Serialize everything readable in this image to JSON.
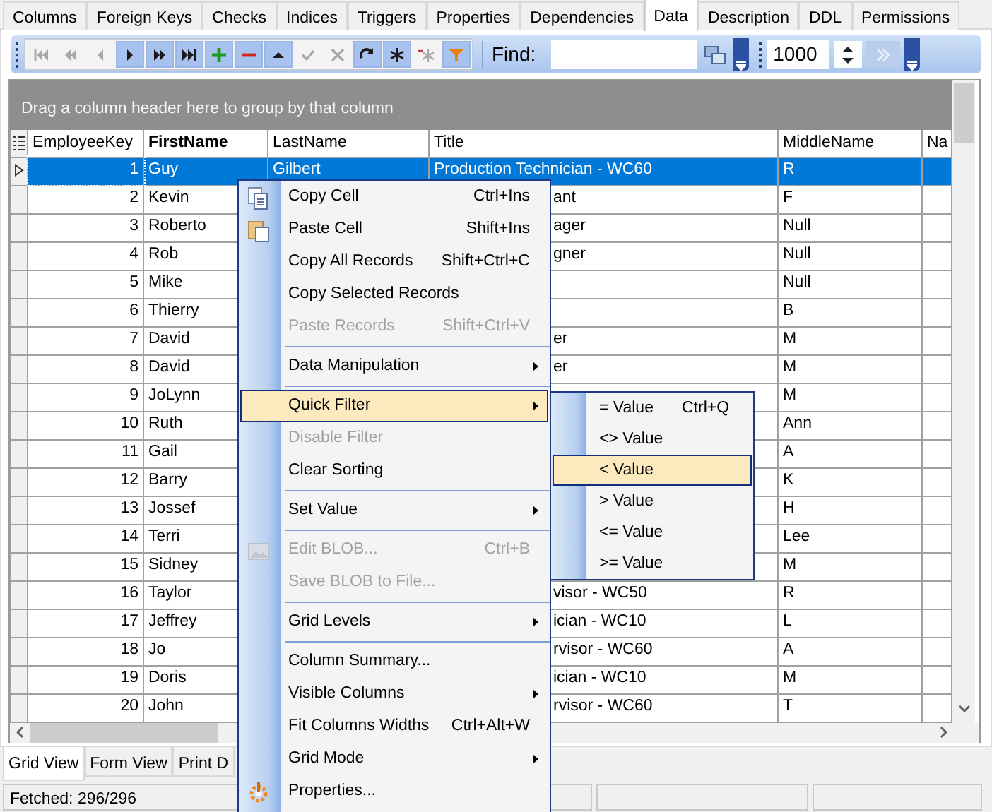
{
  "tabs": [
    {
      "label": "Columns",
      "selected": false
    },
    {
      "label": "Foreign Keys",
      "selected": false
    },
    {
      "label": "Checks",
      "selected": false
    },
    {
      "label": "Indices",
      "selected": false
    },
    {
      "label": "Triggers",
      "selected": false
    },
    {
      "label": "Properties",
      "selected": false
    },
    {
      "label": "Dependencies",
      "selected": false
    },
    {
      "label": "Data",
      "selected": true
    },
    {
      "label": "Description",
      "selected": false
    },
    {
      "label": "DDL",
      "selected": false
    },
    {
      "label": "Permissions",
      "selected": false
    }
  ],
  "toolbar": {
    "buttons": [
      {
        "kind": "first",
        "disabled": true
      },
      {
        "kind": "prior-page",
        "disabled": true
      },
      {
        "kind": "prior",
        "disabled": true
      },
      {
        "kind": "next",
        "disabled": false
      },
      {
        "kind": "next-page",
        "disabled": false
      },
      {
        "kind": "last",
        "disabled": false
      },
      {
        "kind": "insert",
        "disabled": false
      },
      {
        "kind": "delete",
        "disabled": false
      },
      {
        "kind": "edit",
        "disabled": false
      },
      {
        "kind": "post",
        "disabled": true
      },
      {
        "kind": "cancel",
        "disabled": true
      },
      {
        "kind": "refresh",
        "disabled": false
      },
      {
        "kind": "bookmark",
        "disabled": false
      },
      {
        "kind": "goto-bookmark",
        "disabled": true
      },
      {
        "kind": "filter",
        "disabled": false
      }
    ],
    "find_label": "Find:",
    "record_count": "1000"
  },
  "group_panel": "Drag a column header here to group by that column",
  "grid": {
    "columns": [
      {
        "label": "EmployeeKey",
        "selected": false
      },
      {
        "label": "FirstName",
        "selected": true
      },
      {
        "label": "LastName",
        "selected": false
      },
      {
        "label": "Title",
        "selected": false
      },
      {
        "label": "MiddleName",
        "selected": false
      },
      {
        "label": "Na",
        "selected": false
      }
    ],
    "rows": [
      {
        "cells": [
          "1",
          "Guy",
          "Gilbert",
          "Production Technician - WC60",
          "R"
        ],
        "selected": true
      },
      {
        "cells": [
          "2",
          "Kevin",
          "",
          "ant",
          "F"
        ],
        "selected": false
      },
      {
        "cells": [
          "3",
          "Roberto",
          "",
          "ager",
          "Null"
        ],
        "selected": false
      },
      {
        "cells": [
          "4",
          "Rob",
          "",
          "gner",
          "Null"
        ],
        "selected": false
      },
      {
        "cells": [
          "5",
          "Mike",
          "",
          "",
          "Null"
        ],
        "selected": false
      },
      {
        "cells": [
          "6",
          "Thierry",
          "",
          "",
          "B"
        ],
        "selected": false
      },
      {
        "cells": [
          "7",
          "David",
          "",
          "er",
          "M"
        ],
        "selected": false
      },
      {
        "cells": [
          "8",
          "David",
          "",
          "er",
          "M"
        ],
        "selected": false
      },
      {
        "cells": [
          "9",
          "JoLynn",
          "",
          "",
          "M"
        ],
        "selected": false
      },
      {
        "cells": [
          "10",
          "Ruth",
          "",
          "",
          "Ann"
        ],
        "selected": false
      },
      {
        "cells": [
          "11",
          "Gail",
          "",
          "",
          "A"
        ],
        "selected": false
      },
      {
        "cells": [
          "12",
          "Barry",
          "",
          "",
          "K"
        ],
        "selected": false
      },
      {
        "cells": [
          "13",
          "Jossef",
          "",
          "",
          "H"
        ],
        "selected": false
      },
      {
        "cells": [
          "14",
          "Terri",
          "",
          "",
          "Lee"
        ],
        "selected": false
      },
      {
        "cells": [
          "15",
          "Sidney",
          "",
          "",
          "M"
        ],
        "selected": false
      },
      {
        "cells": [
          "16",
          "Taylor",
          "",
          "visor - WC50",
          "R"
        ],
        "selected": false
      },
      {
        "cells": [
          "17",
          "Jeffrey",
          "",
          "ician - WC10",
          "L"
        ],
        "selected": false
      },
      {
        "cells": [
          "18",
          "Jo",
          "",
          "rvisor - WC60",
          "A"
        ],
        "selected": false
      },
      {
        "cells": [
          "19",
          "Doris",
          "",
          "ician - WC10",
          "M"
        ],
        "selected": false
      },
      {
        "cells": [
          "20",
          "John",
          "",
          "rvisor - WC60",
          "T"
        ],
        "selected": false
      }
    ]
  },
  "view_tabs": [
    {
      "label": "Grid View",
      "selected": true
    },
    {
      "label": "Form View",
      "selected": false
    },
    {
      "label": "Print D",
      "selected": false
    }
  ],
  "status_bar": "Fetched: 296/296",
  "context_menu": [
    {
      "kind": "item",
      "label": "Copy Cell",
      "shortcut": "Ctrl+Ins"
    },
    {
      "kind": "item",
      "label": "Paste Cell",
      "shortcut": "Shift+Ins"
    },
    {
      "kind": "item",
      "label": "Copy All Records",
      "shortcut": "Shift+Ctrl+C"
    },
    {
      "kind": "item",
      "label": "Copy Selected Records"
    },
    {
      "kind": "item",
      "label": "Paste Records",
      "shortcut": "Shift+Ctrl+V",
      "disabled": true
    },
    {
      "kind": "separator"
    },
    {
      "kind": "submenu",
      "label": "Data Manipulation"
    },
    {
      "kind": "separator"
    },
    {
      "kind": "submenu",
      "label": "Quick Filter",
      "selected": true
    },
    {
      "kind": "item",
      "label": "Disable Filter",
      "disabled": true
    },
    {
      "kind": "item",
      "label": "Clear Sorting"
    },
    {
      "kind": "separator"
    },
    {
      "kind": "submenu",
      "label": "Set Value"
    },
    {
      "kind": "separator"
    },
    {
      "kind": "item",
      "label": "Edit BLOB...",
      "shortcut": "Ctrl+B",
      "disabled": true
    },
    {
      "kind": "item",
      "label": "Save BLOB to File...",
      "disabled": true
    },
    {
      "kind": "separator"
    },
    {
      "kind": "submenu",
      "label": "Grid Levels"
    },
    {
      "kind": "separator"
    },
    {
      "kind": "item",
      "label": "Column Summary..."
    },
    {
      "kind": "submenu",
      "label": "Visible Columns"
    },
    {
      "kind": "item",
      "label": "Fit Columns Widths",
      "shortcut": "Ctrl+Alt+W"
    },
    {
      "kind": "submenu",
      "label": "Grid Mode"
    },
    {
      "kind": "item",
      "label": "Properties..."
    }
  ],
  "submenu": [
    {
      "label": "= Value",
      "shortcut": "Ctrl+Q",
      "selected": false
    },
    {
      "label": "<> Value",
      "selected": false
    },
    {
      "label": "< Value",
      "selected": true
    },
    {
      "label": "> Value",
      "selected": false
    },
    {
      "label": "<= Value",
      "selected": false
    },
    {
      "label": ">= Value",
      "selected": false
    }
  ]
}
